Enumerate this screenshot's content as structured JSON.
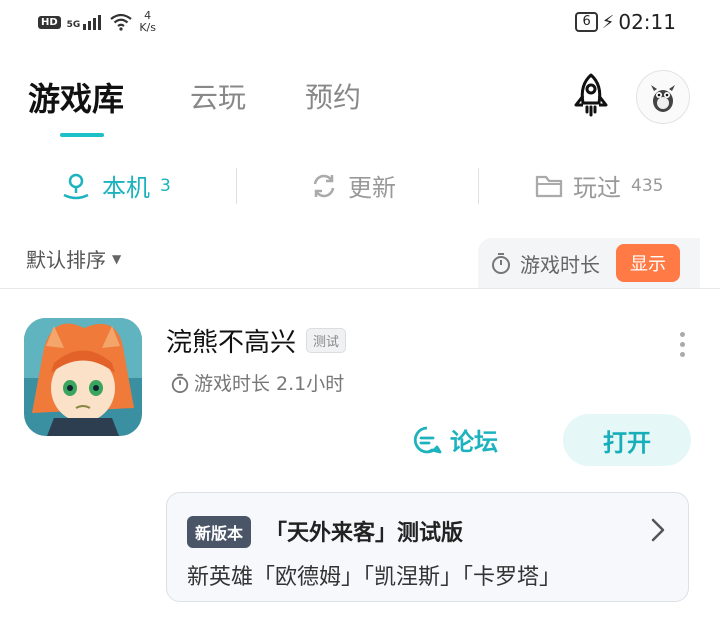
{
  "status_bar": {
    "hd": "HD",
    "network": "5G",
    "speed_value": "4",
    "speed_unit": "K/s",
    "battery": "6",
    "time": "02:11"
  },
  "top_tabs": [
    "游戏库",
    "云玩",
    "预约"
  ],
  "icons": {
    "rocket": "rocket-icon",
    "avatar": "avatar-image"
  },
  "sub_tabs": [
    {
      "label": "本机",
      "count": "3"
    },
    {
      "label": "更新",
      "count": ""
    },
    {
      "label": "玩过",
      "count": "435"
    }
  ],
  "sort_label": "默认排序",
  "duration_filter": {
    "label": "游戏时长",
    "button": "显示"
  },
  "game": {
    "title": "浣熊不高兴",
    "tag": "测试",
    "play_time": "游戏时长 2.1小时",
    "forum_label": "论坛",
    "open_label": "打开",
    "news": {
      "badge": "新版本",
      "title": "「天外来客」测试版",
      "desc": "新英雄「欧德姆」「凯涅斯」「卡罗塔」"
    }
  },
  "colors": {
    "accent": "#1cc0c6",
    "orange": "#ff7a45"
  }
}
